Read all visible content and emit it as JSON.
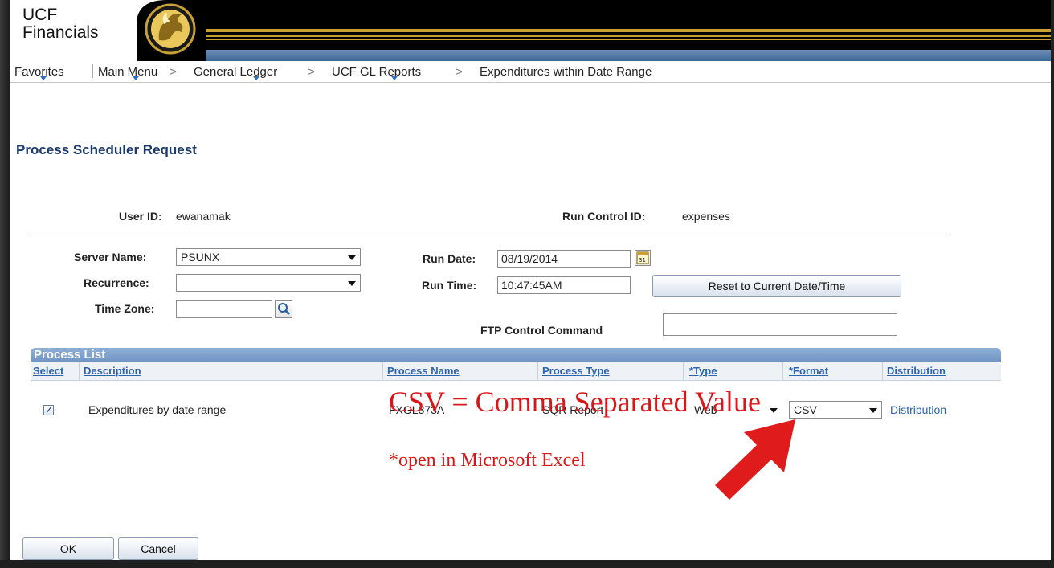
{
  "app": {
    "logo_line1": "UCF",
    "logo_line2": "Financials"
  },
  "nav": {
    "favorites": "Favorites",
    "main_menu": "Main Menu",
    "general_ledger": "General Ledger",
    "ucf_gl_reports": "UCF GL Reports",
    "current_page": "Expenditures within Date Range",
    "separator": ">"
  },
  "page": {
    "title": "Process Scheduler Request",
    "user_id_label": "User ID:",
    "user_id_value": "ewanamak",
    "run_control_label": "Run Control ID:",
    "run_control_value": "expenses"
  },
  "form": {
    "server_name_label": "Server Name:",
    "server_name_value": "PSUNX",
    "recurrence_label": "Recurrence:",
    "recurrence_value": "",
    "time_zone_label": "Time Zone:",
    "time_zone_value": "",
    "run_date_label": "Run Date:",
    "run_date_value": "08/19/2014",
    "run_time_label": "Run Time:",
    "run_time_value": "10:47:45AM",
    "reset_button": "Reset to Current Date/Time",
    "ftp_label": "FTP Control Command",
    "ftp_value": ""
  },
  "process_list": {
    "title": "Process List",
    "columns": [
      "Select",
      "Description",
      "Process Name",
      "Process Type",
      "*Type",
      "*Format",
      "Distribution"
    ],
    "rows": [
      {
        "selected": true,
        "description": "Expenditures by date range",
        "process_name": "FXGL373A",
        "process_type": "SQR Report",
        "type": "Web",
        "format": "CSV",
        "distribution": "Distribution"
      }
    ]
  },
  "buttons": {
    "ok": "OK",
    "cancel": "Cancel"
  },
  "annotation": {
    "main": "CSV = Comma Separated Value",
    "sub": "*open in Microsoft Excel",
    "color": "#d81818"
  },
  "icons": {
    "calendar": "calendar-icon",
    "lookup": "magnifier-icon",
    "arrow": "red-arrow"
  }
}
